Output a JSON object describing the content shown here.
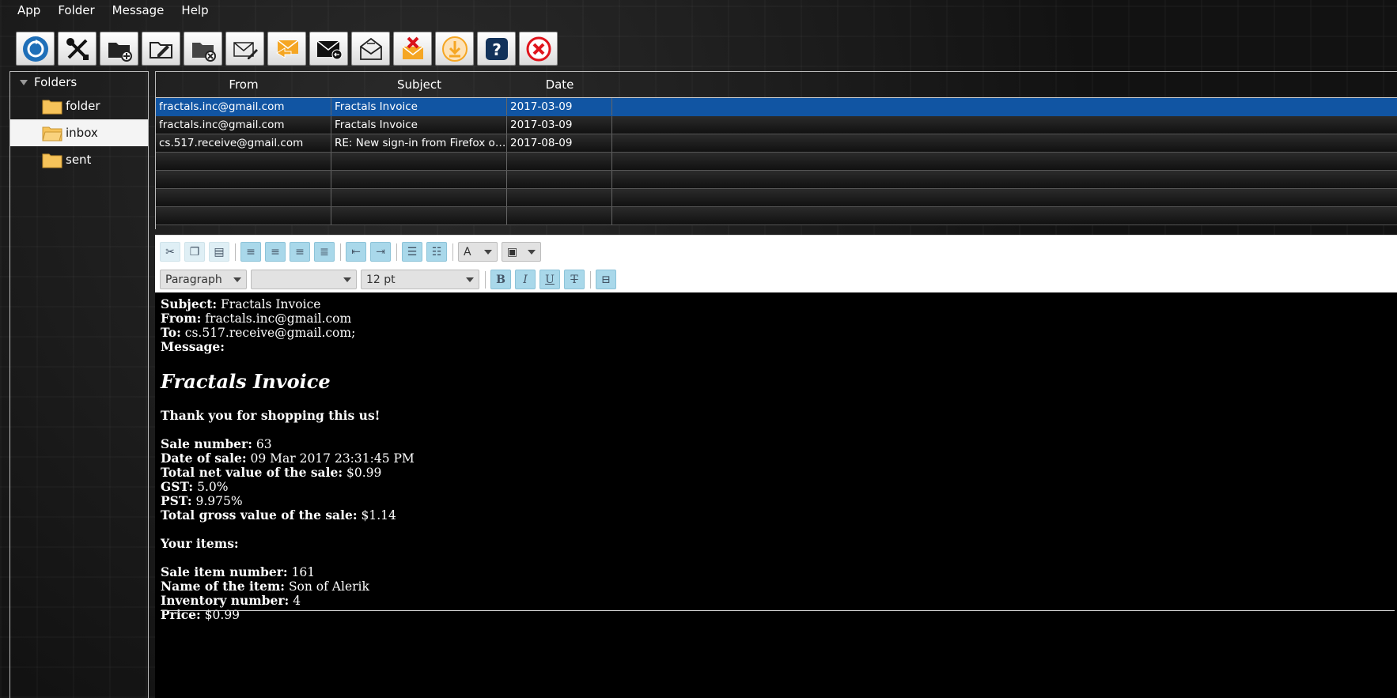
{
  "menu": [
    "App",
    "Folder",
    "Message",
    "Help"
  ],
  "toolbar_icons": [
    "refresh-icon",
    "tools-icon",
    "new-folder-icon",
    "rename-folder-icon",
    "delete-folder-icon",
    "compose-icon",
    "reply-icon",
    "forward-icon",
    "send-receive-icon",
    "delete-message-icon",
    "download-icon",
    "help-icon",
    "exit-icon"
  ],
  "tree": {
    "root": "Folders",
    "items": [
      {
        "label": "folder"
      },
      {
        "label": "inbox",
        "selected": true
      },
      {
        "label": "sent"
      }
    ]
  },
  "table": {
    "columns": [
      "From",
      "Subject",
      "Date"
    ],
    "rows": [
      {
        "from": "fractals.inc@gmail.com",
        "subject": "Fractals Invoice",
        "date": "2017-03-09",
        "selected": true
      },
      {
        "from": "fractals.inc@gmail.com",
        "subject": "Fractals Invoice",
        "date": "2017-03-09"
      },
      {
        "from": "cs.517.receive@gmail.com",
        "subject": "RE: New sign-in from Firefox on Li...",
        "date": "2017-08-09"
      },
      {
        "from": "",
        "subject": "",
        "date": ""
      },
      {
        "from": "",
        "subject": "",
        "date": ""
      },
      {
        "from": "",
        "subject": "",
        "date": ""
      },
      {
        "from": "",
        "subject": "",
        "date": ""
      }
    ]
  },
  "editor": {
    "paragraph_style": "Paragraph",
    "font_family": "",
    "font_size": "12 pt",
    "bold": "B",
    "italic": "I",
    "underline": "U",
    "strike": "T"
  },
  "message": {
    "subject_label": "Subject:",
    "subject": "Fractals Invoice",
    "from_label": "From:",
    "from": "fractals.inc@gmail.com",
    "to_label": "To:",
    "to": "cs.517.receive@gmail.com;",
    "message_label": "Message:",
    "heading": "Fractals Invoice",
    "thanks": "Thank you for shopping this us!",
    "sale_number_label": "Sale number:",
    "sale_number": "63",
    "date_label": "Date of sale:",
    "date": "09 Mar 2017 23:31:45 PM",
    "net_label": "Total net value of the sale:",
    "net": "$0.99",
    "gst_label": "GST:",
    "gst": "5.0%",
    "pst_label": "PST:",
    "pst": "9.975%",
    "gross_label": "Total gross value of the sale:",
    "gross": "$1.14",
    "items_label": "Your items:",
    "item_number_label": "Sale item number:",
    "item_number": "161",
    "item_name_label": "Name of the item:",
    "item_name": "Son of Alerik",
    "inventory_label": "Inventory number:",
    "inventory": "4",
    "price_label": "Price:",
    "price": "$0.99"
  }
}
